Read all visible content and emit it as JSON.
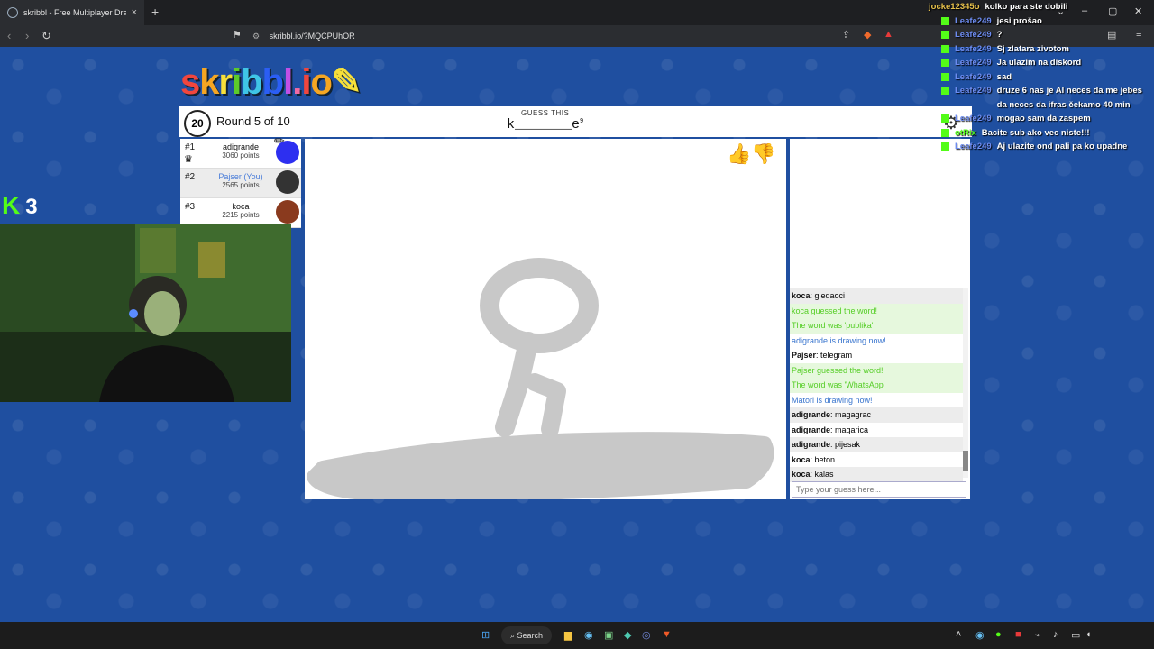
{
  "browser": {
    "tab_title": "skribbl - Free Multiplayer Drawing",
    "tab_close": "×",
    "new_tab": "+",
    "url": "skribbl.io/?MQCPUhOR"
  },
  "game": {
    "logo": "skribbl.io",
    "timer": "20",
    "round": "Round 5 of 10",
    "guess_label": "GUESS THIS",
    "word_hint": "k_______e",
    "word_length": "9",
    "players": [
      {
        "rank": "#1",
        "name": "adigrande",
        "points": "3060 points",
        "avatar_color": "#2d2ff0"
      },
      {
        "rank": "#2",
        "name": "Pajser (You)",
        "points": "2565 points",
        "avatar_color": "#333333"
      },
      {
        "rank": "#3",
        "name": "koca",
        "points": "2215 points",
        "avatar_color": "#8a3a1e"
      }
    ],
    "chat": [
      {
        "user": "koca",
        "text": "gledaoci"
      },
      {
        "text": "koca guessed the word!",
        "kind": "green"
      },
      {
        "text": "The word was 'publika'",
        "kind": "green"
      },
      {
        "text": "adigrande is drawing now!",
        "kind": "blue"
      },
      {
        "user": "Pajser",
        "text": "telegram"
      },
      {
        "text": "Pajser guessed the word!",
        "kind": "green"
      },
      {
        "text": "The word was 'WhatsApp'",
        "kind": "green"
      },
      {
        "text": "Matori is drawing now!",
        "kind": "blue"
      },
      {
        "user": "adigrande",
        "text": "magagrac"
      },
      {
        "user": "adigrande",
        "text": "magarica"
      },
      {
        "user": "adigrande",
        "text": "pijesak"
      },
      {
        "user": "koca",
        "text": "beton"
      },
      {
        "user": "koca",
        "text": "kalas"
      }
    ],
    "input_placeholder": "Type your guess here..."
  },
  "stream": {
    "kick_count": "3",
    "overlay_chat": [
      {
        "user": "jocke12345o",
        "text": "kolko para ste dobili"
      },
      {
        "user": "Leafe249",
        "text": "jesi prošao"
      },
      {
        "user": "Leafe249",
        "text": "?"
      },
      {
        "user": "Leafe249",
        "text": "Sj zlatara zivotom"
      },
      {
        "user": "Leafe249",
        "text": "Ja ulazim na diskord"
      },
      {
        "user": "Leafe249",
        "text": "sad"
      },
      {
        "user": "Leafe249",
        "text": "druze 6 nas je Al neces da me jebes da neces da ifras čekamo 40 min"
      },
      {
        "user": "Leafe249",
        "text": "mogao sam da zaspem"
      },
      {
        "user": "otRix",
        "text": "Bacite sub ako vec niste!!!",
        "green": true
      },
      {
        "user": "Leafe249",
        "text": "Aj ulazite ond pali pa ko upadne"
      }
    ]
  },
  "taskbar": {
    "search": "Search"
  }
}
